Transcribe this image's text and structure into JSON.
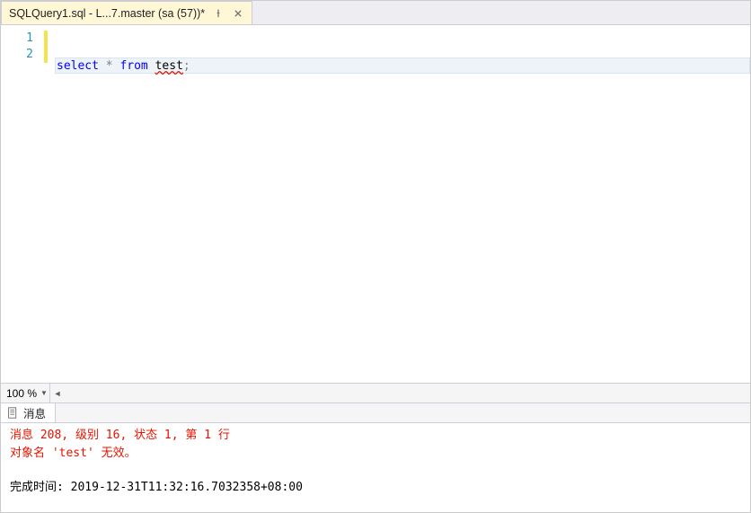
{
  "tab": {
    "title": "SQLQuery1.sql - L...7.master (sa (57))*"
  },
  "editor": {
    "lines": [
      "1",
      "2"
    ],
    "code": {
      "kw1": "select",
      "op": " * ",
      "kw2": "from",
      "sp": " ",
      "ident": "test",
      "term": ";"
    }
  },
  "zoom": {
    "value": "100 %"
  },
  "messages": {
    "tab_label": "消息",
    "line1": "消息 208, 级别 16, 状态 1, 第 1 行",
    "line2": "对象名 'test' 无效。",
    "completion": "完成时间: 2019-12-31T11:32:16.7032358+08:00"
  }
}
